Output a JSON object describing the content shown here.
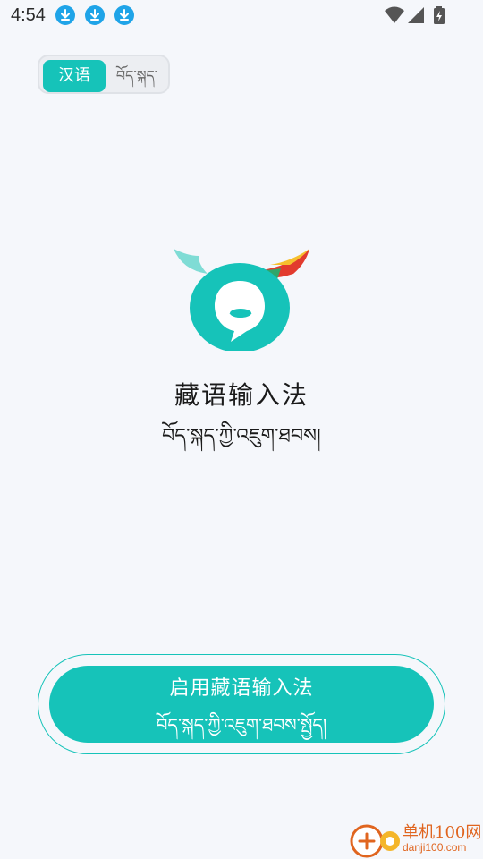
{
  "status_bar": {
    "time": "4:54",
    "notification_icons": [
      "download-icon",
      "download-icon",
      "download-icon"
    ],
    "system_icons": [
      "wifi-icon",
      "signal-icon",
      "battery-charging-icon"
    ]
  },
  "language_toggle": {
    "options": [
      "汉语",
      "བོད་སྐད་"
    ],
    "selected": "汉语"
  },
  "app": {
    "name_cn": "藏语输入法",
    "name_bo": "བོད་སྐད་ཀྱི་འཇུག་ཐབས།",
    "logo": "yak-chat-bubble-logo"
  },
  "enable_button": {
    "label_cn": "启用藏语输入法",
    "label_bo": "བོད་སྐད་ཀྱི་འཇུག་ཐབས་སྤྱོད།"
  },
  "watermark": {
    "text": "单机100网",
    "url_text": "danji100.com"
  },
  "colors": {
    "accent": "#16c3b9",
    "background": "#f5f7fb"
  }
}
